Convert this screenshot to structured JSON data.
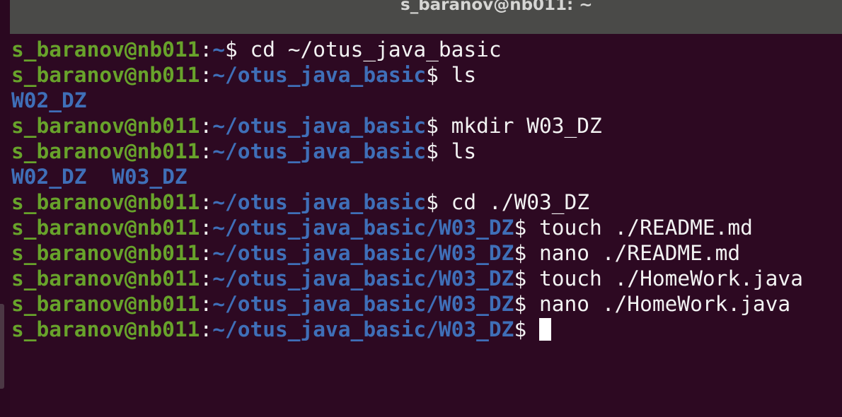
{
  "window": {
    "title": "s_baranov@nb011: ~"
  },
  "terminal": {
    "lines": [
      {
        "kind": "prompt",
        "user": "s_baranov@nb011",
        "sep": ":",
        "path": "~",
        "dollar": "$",
        "command": " cd ~/otus_java_basic"
      },
      {
        "kind": "prompt",
        "user": "s_baranov@nb011",
        "sep": ":",
        "path": "~/otus_java_basic",
        "dollar": "$",
        "command": " ls"
      },
      {
        "kind": "output",
        "text": "W02_DZ"
      },
      {
        "kind": "prompt",
        "user": "s_baranov@nb011",
        "sep": ":",
        "path": "~/otus_java_basic",
        "dollar": "$",
        "command": " mkdir W03_DZ"
      },
      {
        "kind": "prompt",
        "user": "s_baranov@nb011",
        "sep": ":",
        "path": "~/otus_java_basic",
        "dollar": "$",
        "command": " ls"
      },
      {
        "kind": "output",
        "text": "W02_DZ  W03_DZ"
      },
      {
        "kind": "prompt",
        "user": "s_baranov@nb011",
        "sep": ":",
        "path": "~/otus_java_basic",
        "dollar": "$",
        "command": " cd ./W03_DZ"
      },
      {
        "kind": "prompt",
        "user": "s_baranov@nb011",
        "sep": ":",
        "path": "~/otus_java_basic/W03_DZ",
        "dollar": "$",
        "command": " touch ./README.md"
      },
      {
        "kind": "prompt",
        "user": "s_baranov@nb011",
        "sep": ":",
        "path": "~/otus_java_basic/W03_DZ",
        "dollar": "$",
        "command": " nano ./README.md"
      },
      {
        "kind": "prompt",
        "user": "s_baranov@nb011",
        "sep": ":",
        "path": "~/otus_java_basic/W03_DZ",
        "dollar": "$",
        "command": " touch ./HomeWork.java"
      },
      {
        "kind": "prompt",
        "user": "s_baranov@nb011",
        "sep": ":",
        "path": "~/otus_java_basic/W03_DZ",
        "dollar": "$",
        "command": " nano ./HomeWork.java"
      },
      {
        "kind": "prompt",
        "user": "s_baranov@nb011",
        "sep": ":",
        "path": "~/otus_java_basic/W03_DZ",
        "dollar": "$",
        "command": "",
        "cursor": true
      }
    ]
  },
  "colors": {
    "background": "#2d0922",
    "user": "#68a32b",
    "path": "#3f6fb8",
    "text": "#f2f2f2",
    "titlebar": "#4a4a48"
  }
}
